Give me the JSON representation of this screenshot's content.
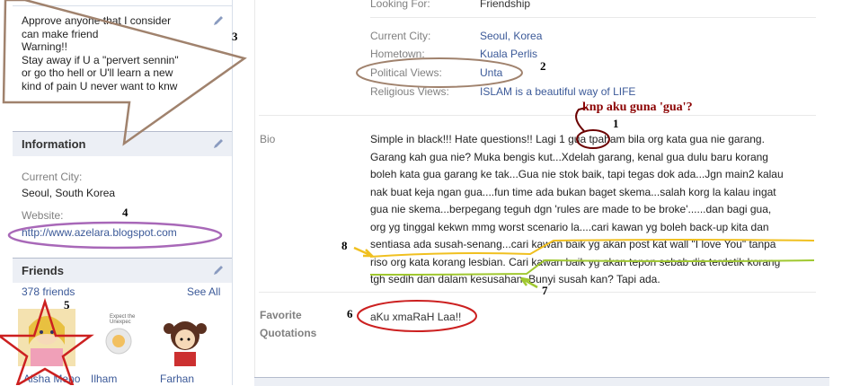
{
  "intro": {
    "text": "Approve anyone that I consider\ncan make friend\nWarning!!\nStay away if U a \"pervert sennin\"\nor go tho hell or U'll learn a new\nkind of pain U never want to knw"
  },
  "information": {
    "title": "Information",
    "current_city_label": "Current City:",
    "current_city_value": "Seoul, South Korea",
    "website_label": "Website:",
    "website_value": "http://www.azelara.blogspot.com"
  },
  "friends": {
    "title": "Friends",
    "count": "378 friends",
    "see_all": "See All",
    "items": [
      {
        "name": "Aisha Meno"
      },
      {
        "name": "Ilham"
      },
      {
        "name": "Farhan"
      }
    ],
    "ilham_pic_caption": "Expect the Unexpec"
  },
  "profile": {
    "looking_for_label": "Looking For:",
    "looking_for_value": "Friendship",
    "current_city_label": "Current City:",
    "current_city_value": "Seoul, Korea",
    "hometown_label": "Hometown:",
    "hometown_value": "Kuala Perlis",
    "political_label": "Political Views:",
    "political_value": "Unta",
    "religious_label": "Religious Views:",
    "religious_value": "ISLAM is a beautiful way of LIFE",
    "bio_label": "Bio",
    "bio_lines": [
      "Simple in black!!! Hate questions!! Lagi 1 gua tpaham bila org kata gua nie garang.",
      "Garang kah gua nie? Muka bengis kut...Xdelah garang, kenal gua dulu baru korang",
      "boleh kata gua garang ke tak...Gua nie stok baik, tapi tegas dok ada...Jgn main2 kalau",
      "nak buat keja ngan gua....fun time ada bukan baget skema...salah korg la kalau ingat",
      "gua nie skema...berpegang teguh dgn 'rules are made to be broke'......dan bagi gua,",
      "org yg tinggal kekwn mmg worst scenario la....cari kawan yg boleh back-up kita dan",
      "sentiasa ada susah-senang...cari kawan baik yg akan post kat wall \"I love You\" tanpa",
      "riso org kata korang lesbian. Cari kawan baik yg akan tepon sebab dia terdetik korang",
      "tgh sedih dan dalam kesusahan. Bunyi susah kan? Tapi ada."
    ],
    "quotations_label_1": "Favorite",
    "quotations_label_2": "Quotations",
    "quotations_value": "aKu xmaRaH Laa!!"
  },
  "annotations": {
    "n1": "1",
    "n2": "2",
    "n3": "3",
    "n4": "4",
    "n5": "5",
    "n6": "6",
    "n7": "7",
    "n8": "8",
    "question": "knp aku guna 'gua'?"
  },
  "colors": {
    "link": "#3b5998",
    "header_bg": "#eceff5",
    "annot_brown": "#a0826d",
    "annot_purple": "#a868b8",
    "annot_red": "#cc2020",
    "annot_yellow": "#f0c020",
    "annot_green": "#a0c830",
    "annot_darkred": "#8b0000"
  }
}
